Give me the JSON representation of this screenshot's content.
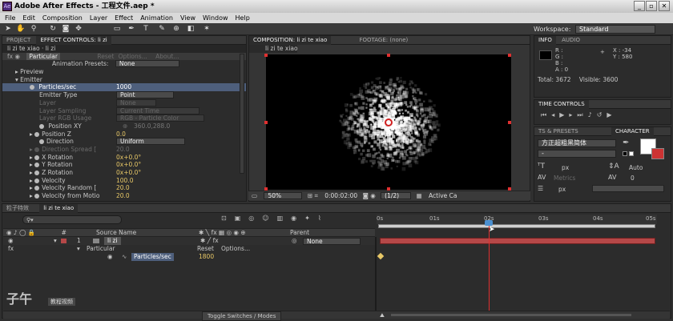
{
  "window": {
    "title": "Adobe After Effects - 工程文件.aep *",
    "minimize": "_",
    "restore": "▫",
    "close": "✕"
  },
  "menu": [
    "File",
    "Edit",
    "Composition",
    "Layer",
    "Effect",
    "Animation",
    "View",
    "Window",
    "Help"
  ],
  "workspace": {
    "label": "Workspace:",
    "value": "Standard"
  },
  "left_panel": {
    "tabs": [
      "PROJECT",
      "EFFECT CONTROLS: li zi"
    ],
    "crumb": "li zi te xiao · li zi",
    "effect": {
      "name": "Particular",
      "reset": "Reset",
      "options": "Options...",
      "about": "About..."
    },
    "anim_presets_label": "Animation Presets:",
    "anim_presets_value": "None",
    "sections": [
      "Preview",
      "Emitter"
    ],
    "rows": [
      {
        "label": "Particles/sec",
        "value": "1000"
      },
      {
        "label": "Emitter Type",
        "value": "Point"
      },
      {
        "label": "Layer",
        "value": "None"
      },
      {
        "label": "Layer Sampling",
        "value": "Current Time"
      },
      {
        "label": "Layer RGB Usage",
        "value": "RGB - Particle Color"
      },
      {
        "label": "Position XY",
        "value": "360.0,288.0"
      },
      {
        "label": "Position Z",
        "value": "0.0"
      },
      {
        "label": "Direction",
        "value": "Uniform"
      },
      {
        "label": "Direction Spread [",
        "value": "20.0"
      },
      {
        "label": "X Rotation",
        "value": "0x+0.0°"
      },
      {
        "label": "Y Rotation",
        "value": "0x+0.0°"
      },
      {
        "label": "Z Rotation",
        "value": "0x+0.0°"
      },
      {
        "label": "Velocity",
        "value": "100.0"
      },
      {
        "label": "Velocity Random [",
        "value": "20.0"
      },
      {
        "label": "Velocity from Motio",
        "value": "20.0"
      }
    ]
  },
  "center_panel": {
    "tabs": [
      "COMPOSITION: li zi te xiao",
      "FOOTAGE: (none)"
    ],
    "crumb": "li zi te xiao",
    "zoom": "50%",
    "timecode": "0:00:02:00",
    "resolution": "(1/2)",
    "camera": "Active Ca"
  },
  "info_panel": {
    "tabs": [
      "INFO",
      "AUDIO"
    ],
    "r": "R :",
    "g": "G :",
    "b": "B :",
    "a": "A : 0",
    "x": "X : -34",
    "y": "Y : 580",
    "total": "Total: 3672",
    "visible": "Visible: 3600"
  },
  "time_controls": {
    "tab": "TIME CONTROLS"
  },
  "char_panel": {
    "tabs": [
      "TS & PRESETS",
      "CHARACTER"
    ],
    "font": "方正超粗黑简体",
    "style": "-",
    "size": "px",
    "leading": "Auto",
    "metrics": "Metrics",
    "tracking": "0",
    "indent": "px"
  },
  "timeline": {
    "tabs": [
      "粒子特效",
      "li zi te xiao"
    ],
    "search": "",
    "columns": {
      "source": "Source Name",
      "parent": "Parent"
    },
    "layer": {
      "num": "1",
      "name": "li zi",
      "parent": "None"
    },
    "effect": {
      "name": "Particular",
      "reset": "Reset",
      "options": "Options..."
    },
    "property": {
      "name": "Particles/sec",
      "value": "1800"
    },
    "ruler": [
      "0s",
      "01s",
      "02s",
      "03s",
      "04s",
      "05s"
    ],
    "toggle": "Toggle Switches / Modes"
  },
  "watermark": {
    "text": "子午",
    "sub": "教程视频"
  },
  "colors": {
    "accent": "#e8c867",
    "layer_bar": "#b54848",
    "playhead": "#e03030",
    "selected_row": "#4e5f7c"
  }
}
